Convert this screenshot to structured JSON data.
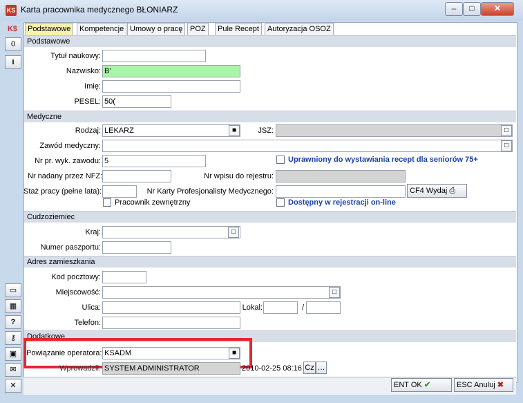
{
  "window": {
    "title": "Karta pracownika medycznego BŁONIARZ"
  },
  "left_toolbar": [
    {
      "label": "0"
    },
    {
      "label": "i"
    }
  ],
  "tabs": [
    {
      "label": "Podstawowe"
    },
    {
      "label": "Kompetencje"
    },
    {
      "label": "Umowy o pracę"
    },
    {
      "label": "POZ"
    },
    {
      "label": "Pule Recept"
    },
    {
      "label": "Autoryzacja OSOZ"
    }
  ],
  "sections": {
    "podstawowe": "Podstawowe",
    "medyczne": "Medyczne",
    "cudzoziemiec": "Cudzoziemiec",
    "adres": "Adres zamieszkania",
    "dodatkowe": "Dodatkowe"
  },
  "fields": {
    "tytul_label": "Tytuł naukowy:",
    "tytul_value": "",
    "nazwisko_label": "Nazwisko:",
    "nazwisko_value": "B'",
    "imie_label": "Imię:",
    "imie_value": "",
    "pesel_label": "PESEL:",
    "pesel_value": "50(",
    "rodzaj_label": "Rodzaj:",
    "rodzaj_value": "LEKARZ",
    "jsz_label": "JSZ:",
    "jsz_value": "",
    "zawod_label": "Zawód medyczny:",
    "zawod_value": "",
    "nr_pr_label": "Nr pr. wyk. zawodu:",
    "nr_pr_value": "5",
    "senior_label": "Uprawniony do wystawiania recept dla seniorów 75+",
    "nfz_label": "Nr nadany przez NFZ:",
    "nfz_value": "",
    "rejestr_label": "Nr wpisu do rejestru:",
    "rejestr_value": "",
    "staz_label": "Staż pracy (pełne lata):",
    "staz_value": "",
    "karta_label": "Nr Karty Profesjonalisty Medycznego:",
    "karta_value": "",
    "wydaj_label": "CF4 Wydaj",
    "zewnetrzny_label": "Pracownik zewnętrzny",
    "online_label": "Dostępny w rejestracji on-line",
    "kraj_label": "Kraj:",
    "kraj_value": "",
    "paszport_label": "Numer paszportu:",
    "paszport_value": "",
    "kod_label": "Kod pocztowy:",
    "kod_value": "",
    "miejscowosc_label": "Miejscowość:",
    "miejscowosc_value": "",
    "ulica_label": "Ulica:",
    "ulica_value": "",
    "lokal_label": "Lokal:",
    "lokal_value": "",
    "lokal2_value": "",
    "telefon_label": "Telefon:",
    "telefon_value": "",
    "operator_label": "Powiązanie operatora:",
    "operator_value": "KSADM",
    "wprowadzil_label": "Wprowadził:",
    "wprowadzil_value": "SYSTEM ADMINISTRATOR",
    "wprowadzil_date": "2010-02-25 08:16",
    "cz_label": "Cz"
  },
  "buttons": {
    "ok": "ENT OK",
    "cancel": "ESC Anuluj"
  },
  "colors": {
    "accent_red": "#e4262e",
    "green_field": "#a8f5a8",
    "active_tab": "#f7f2b0"
  }
}
